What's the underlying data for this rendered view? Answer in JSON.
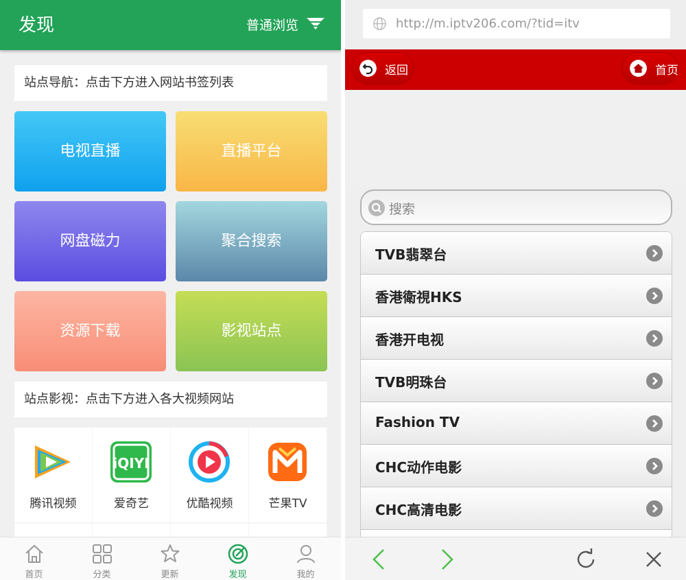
{
  "left": {
    "header": {
      "title": "发现",
      "mode_label": "普通浏览"
    },
    "nav_section": {
      "heading": "站点导航：点击下方进入网站书签列表"
    },
    "tiles": [
      {
        "label": "电视直播"
      },
      {
        "label": "直播平台"
      },
      {
        "label": "网盘磁力"
      },
      {
        "label": "聚合搜索"
      },
      {
        "label": "资源下载"
      },
      {
        "label": "影视站点"
      }
    ],
    "video_section": {
      "heading": "站点影视：点击下方进入各大视频网站"
    },
    "apps": [
      {
        "label": "腾讯视频",
        "icon": "tencent-video-logo"
      },
      {
        "label": "爱奇艺",
        "icon": "iqiyi-logo"
      },
      {
        "label": "优酷视频",
        "icon": "youku-logo"
      },
      {
        "label": "芒果TV",
        "icon": "mango-tv-logo"
      }
    ],
    "tabbar": [
      {
        "label": "首页",
        "icon": "home-icon"
      },
      {
        "label": "分类",
        "icon": "grid-icon"
      },
      {
        "label": "更新",
        "icon": "star-icon"
      },
      {
        "label": "发现",
        "icon": "target-icon",
        "active": true
      },
      {
        "label": "我的",
        "icon": "user-icon"
      }
    ],
    "colors": {
      "primary": "#22a358"
    }
  },
  "right": {
    "url": "http://m.iptv206.com/?tid=itv",
    "toolbar": {
      "back_label": "返回",
      "home_label": "首页",
      "bar_color": "#cc0000"
    },
    "search": {
      "placeholder": "搜索"
    },
    "channels": [
      {
        "name": "TVB翡翠台"
      },
      {
        "name": "香港衛視HKS"
      },
      {
        "name": "香港开电视"
      },
      {
        "name": "TVB明珠台"
      },
      {
        "name": "Fashion TV"
      },
      {
        "name": "CHC动作电影"
      },
      {
        "name": "CHC高清电影"
      }
    ],
    "browser_nav": [
      "back-arrow-icon",
      "forward-arrow-icon",
      "refresh-icon",
      "close-icon"
    ]
  }
}
